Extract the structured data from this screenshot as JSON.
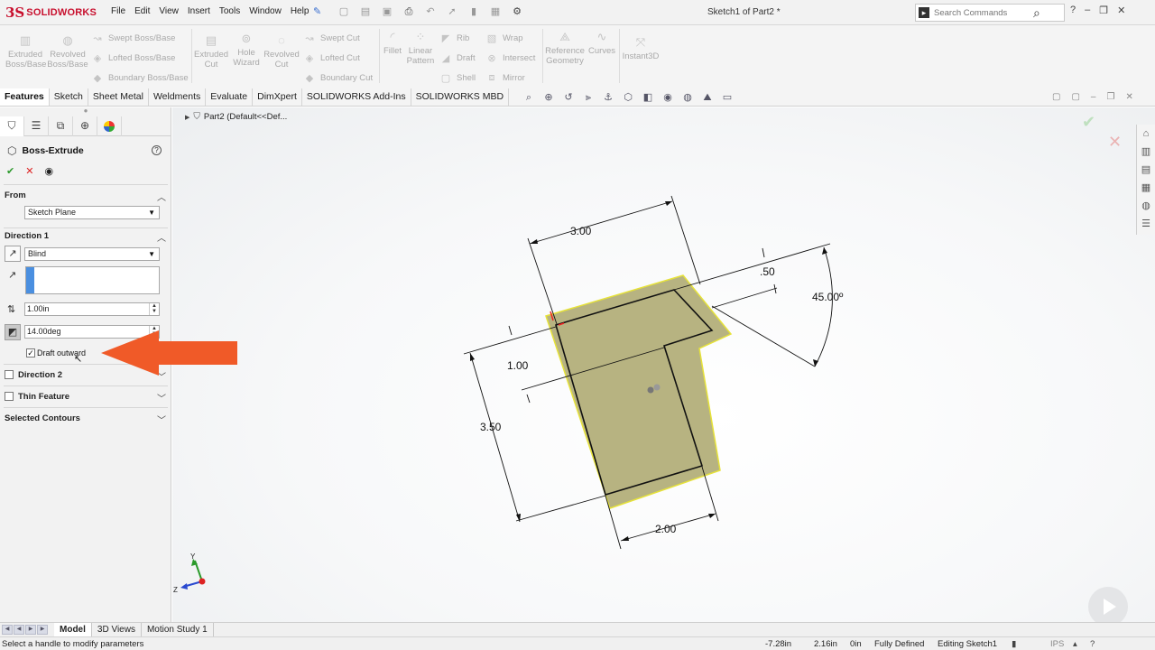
{
  "app": {
    "brand_ds": "3S",
    "brand_name": "SOLIDWORKS",
    "doc_title": "Sketch1 of Part2 *"
  },
  "menu": [
    "File",
    "Edit",
    "View",
    "Insert",
    "Tools",
    "Window",
    "Help"
  ],
  "search": {
    "placeholder": "Search Commands"
  },
  "commands": {
    "extruded_boss": "Extruded\nBoss/Base",
    "revolved_boss": "Revolved\nBoss/Base",
    "swept_boss": "Swept Boss/Base",
    "lofted_boss": "Lofted Boss/Base",
    "boundary_boss": "Boundary Boss/Base",
    "extruded_cut": "Extruded\nCut",
    "hole_wizard": "Hole\nWizard",
    "revolved_cut": "Revolved\nCut",
    "swept_cut": "Swept Cut",
    "lofted_cut": "Lofted Cut",
    "boundary_cut": "Boundary Cut",
    "fillet": "Fillet",
    "linear_pattern": "Linear\nPattern",
    "rib": "Rib",
    "draft": "Draft",
    "shell": "Shell",
    "wrap": "Wrap",
    "intersect": "Intersect",
    "mirror": "Mirror",
    "reference_geometry": "Reference\nGeometry",
    "curves": "Curves",
    "instant3d": "Instant3D"
  },
  "tabs": [
    "Features",
    "Sketch",
    "Sheet Metal",
    "Weldments",
    "Evaluate",
    "DimXpert",
    "SOLIDWORKS Add-Ins",
    "SOLIDWORKS MBD"
  ],
  "property_manager": {
    "title": "Boss-Extrude",
    "from_label": "From",
    "from_value": "Sketch Plane",
    "direction1_label": "Direction 1",
    "end_condition": "Blind",
    "depth": "1.00in",
    "draft_angle": "14.00deg",
    "draft_outward_label": "Draft outward",
    "draft_outward_checked": true,
    "direction2_label": "Direction 2",
    "thin_feature_label": "Thin Feature",
    "selected_contours_label": "Selected Contours"
  },
  "tree_flyout": {
    "label": "Part2  (Default<<Def..."
  },
  "dimensions": {
    "top_width": "3.00",
    "top_offset": ".50",
    "angle": "45.00º",
    "step": "1.00",
    "height": "3.50",
    "bottom_width": "2.00"
  },
  "bottom_tabs": [
    "Model",
    "3D Views",
    "Motion Study 1"
  ],
  "status": {
    "message": "Select a handle to modify parameters",
    "x": "-7.28in",
    "y": "2.16in",
    "z": "0in",
    "state": "Fully Defined",
    "editing": "Editing Sketch1",
    "units": "IPS"
  },
  "colors": {
    "brand": "#c8102e",
    "preview_fill": "#b3af7a",
    "preview_edge": "#e6e23a",
    "callout_arrow": "#f05a28",
    "accent_blue": "#4a8fe0"
  }
}
